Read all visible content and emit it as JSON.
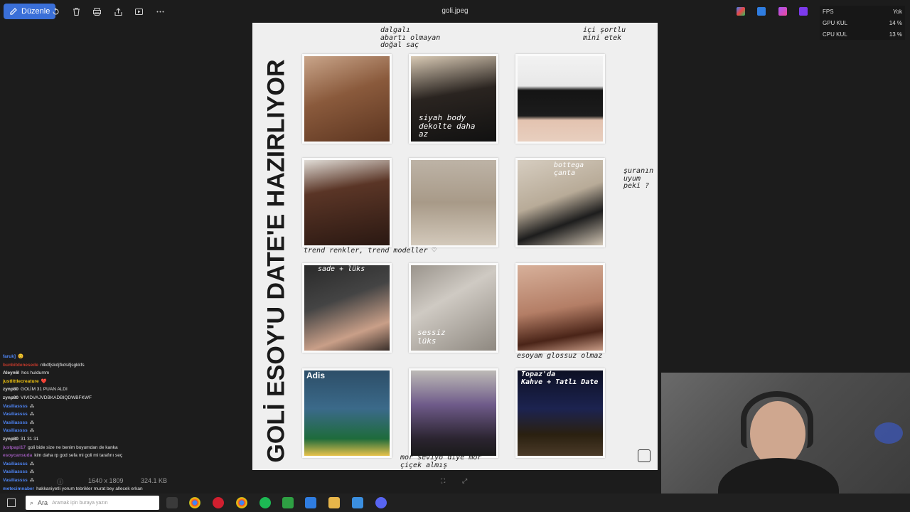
{
  "window": {
    "title": "goli.jpeg"
  },
  "toolbar": {
    "edit_label": "Düzenle",
    "icons": [
      "rotate-icon",
      "delete-icon",
      "print-icon",
      "share-icon",
      "slideshow-icon",
      "more-icon"
    ]
  },
  "stats": {
    "fps_label": "FPS",
    "fps_value": "Yok",
    "gpu_label": "GPU KUL",
    "gpu_value": "14 %",
    "cpu_label": "CPU KUL",
    "cpu_value": "13 %"
  },
  "image": {
    "vertical_title": "GOLİ ESOY'U DATE'E HAZIRLIYOR",
    "notes": {
      "hair": "dalgalı\nabartı olmayan\ndoğal saç",
      "skirt": "içi şortlu\nmini etek",
      "body": "siyah body\ndekolte daha\naz",
      "bag": "bottega\nçanta",
      "side": "şuranın\nuyum\npeki ?",
      "trend": "trend renkler, trend modeller ♡",
      "luxury": "sade + lüks",
      "watch": "sessiz\nlüks",
      "gloss": "esoyam glossuz olmaz",
      "name": "Adis",
      "flowers": "mor seviyo diye mor\nçiçek almış",
      "topaz": "Topaz'da\nKahve + Tatlı Date"
    }
  },
  "infobar": {
    "dimensions": "1640 x 1809",
    "filesize": "324.1 KB"
  },
  "chat": [
    {
      "user": "faruk]",
      "text": "😊",
      "color": "#4f86f7"
    },
    {
      "user": "bunbitdenesede",
      "text": "nlkdfjskdjfkdsifjsgkkfs",
      "color": "#c0392b"
    },
    {
      "user": "Aleyn6l",
      "text": "hos huldumm",
      "color": "#e0e0e0"
    },
    {
      "user": "justlittlecreature",
      "text": "❤️",
      "color": "#f1c40f"
    },
    {
      "user": "zynp80",
      "text": "GOLİM 31 PUAN ALDI",
      "color": "#e0e0e0"
    },
    {
      "user": "zynp80",
      "text": "VIVIDVAJVDBKADBIQDWBFKWF",
      "color": "#e0e0e0"
    },
    {
      "user": "Vasiliassss",
      "text": "⁂",
      "color": "#4f86f7"
    },
    {
      "user": "Vasiliassss",
      "text": "⁂",
      "color": "#4f86f7"
    },
    {
      "user": "Vasiliassss",
      "text": "⁂",
      "color": "#4f86f7"
    },
    {
      "user": "Vasiliassss",
      "text": "⁂",
      "color": "#4f86f7"
    },
    {
      "user": "zynp80",
      "text": "31 31 31",
      "color": "#e0e0e0"
    },
    {
      "user": "justpapi17",
      "text": "goli bide size ne benim boyumdan de kanka",
      "color": "#9b59b6"
    },
    {
      "user": "esoycansuda",
      "text": "kim daha rp god sefa mi goli mi tarafını seç",
      "color": "#9b59b6"
    },
    {
      "user": "Vasiliassss",
      "text": "⁂",
      "color": "#4f86f7"
    },
    {
      "user": "Vasiliassss",
      "text": "⁂",
      "color": "#4f86f7"
    },
    {
      "user": "Vasiliassss",
      "text": "⁂",
      "color": "#4f86f7"
    },
    {
      "user": "metecimnaber",
      "text": "hakkaniyetli yorum tebrikler murat bey allecek erkan",
      "color": "#4f86f7"
    }
  ],
  "taskbar": {
    "search_label": "Ara",
    "search_placeholder": "Aramak için buraya yazın"
  }
}
